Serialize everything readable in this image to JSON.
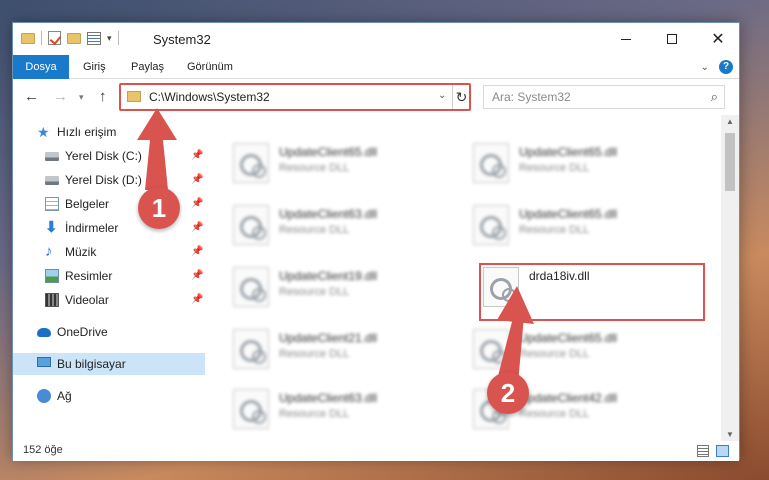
{
  "window": {
    "title": "System32",
    "controls": {
      "minimize": "",
      "maximize": "",
      "close": "✕"
    }
  },
  "ribbon": {
    "tabs": [
      "Dosya",
      "Giriş",
      "Paylaş",
      "Görünüm"
    ],
    "help": "?"
  },
  "nav": {
    "address": "C:\\Windows\\System32",
    "search_placeholder": "Ara: System32"
  },
  "sidebar": {
    "items": [
      {
        "label": "Hızlı erişim",
        "icon": "star-icon"
      },
      {
        "label": "Yerel Disk (C:)",
        "icon": "disk-icon",
        "pinned": true
      },
      {
        "label": "Yerel Disk (D:)",
        "icon": "disk-icon",
        "pinned": true
      },
      {
        "label": "Belgeler",
        "icon": "document-icon",
        "pinned": true
      },
      {
        "label": "İndirmeler",
        "icon": "download-icon",
        "pinned": true
      },
      {
        "label": "Müzik",
        "icon": "music-icon",
        "pinned": true
      },
      {
        "label": "Resimler",
        "icon": "pictures-icon",
        "pinned": true
      },
      {
        "label": "Videolar",
        "icon": "videos-icon",
        "pinned": true
      },
      {
        "label": "OneDrive",
        "icon": "cloud-icon"
      },
      {
        "label": "Bu bilgisayar",
        "icon": "computer-icon",
        "selected": true
      },
      {
        "label": "Ağ",
        "icon": "network-icon"
      }
    ]
  },
  "files": [
    {
      "name": "UpdateClient65.dll",
      "type": "Resource DLL"
    },
    {
      "name": "UpdateClient65.dll",
      "type": "Resource DLL"
    },
    {
      "name": "UpdateClient63.dll",
      "type": "Resource DLL"
    },
    {
      "name": "UpdateClient65.dll",
      "type": "Resource DLL"
    },
    {
      "name": "UpdateClient19.dll",
      "type": "Resource DLL"
    },
    {
      "name": "drda18iv.dll",
      "type": "",
      "highlighted": true
    },
    {
      "name": "UpdateClient21.dll",
      "type": "Resource DLL"
    },
    {
      "name": "UpdateClient65.dll",
      "type": "Resource DLL"
    },
    {
      "name": "UpdateClient63.dll",
      "type": "Resource DLL"
    },
    {
      "name": "UpdateClient42.dll",
      "type": "Resource DLL"
    }
  ],
  "status": {
    "item_count": "152 öğe"
  },
  "annotations": {
    "step1": "1",
    "step2": "2",
    "color": "#d9534f"
  }
}
